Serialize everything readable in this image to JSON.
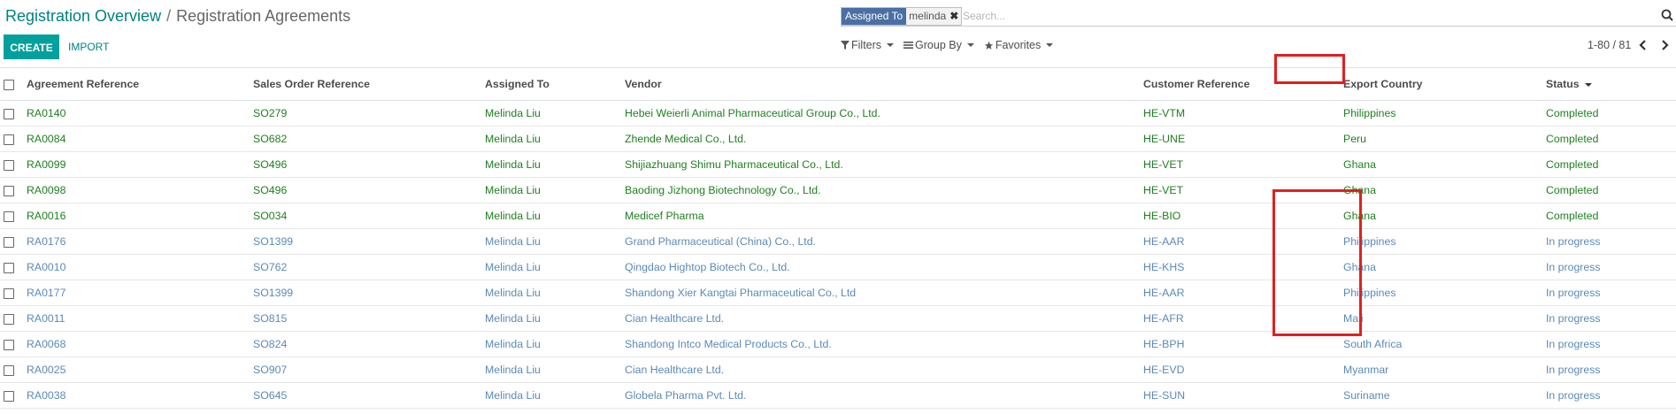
{
  "breadcrumb": {
    "root": "Registration Overview",
    "separator": "/",
    "current": "Registration Agreements"
  },
  "search": {
    "facet_label": "Assigned To",
    "facet_value": "melinda",
    "facet_remove": "✖",
    "placeholder": "Search..."
  },
  "toolbar": {
    "create_label": "CREATE",
    "import_label": "IMPORT"
  },
  "filters": {
    "filters_label": "Filters",
    "group_by_label": "Group By",
    "favorites_label": "Favorites"
  },
  "pager": {
    "text": "1-80 / 81"
  },
  "table": {
    "columns": [
      "Agreement Reference",
      "Sales Order Reference",
      "Assigned To",
      "Vendor",
      "Customer Reference",
      "Export Country",
      "Status"
    ],
    "rows": [
      [
        "RA0140",
        "SO279",
        "Melinda Liu",
        "Hebei Weierli Animal Pharmaceutical Group Co., Ltd.",
        "HE-VTM",
        "Philippines",
        "Completed"
      ],
      [
        "RA0084",
        "SO682",
        "Melinda Liu",
        "Zhende Medical Co., Ltd.",
        "HE-UNE",
        "Peru",
        "Completed"
      ],
      [
        "RA0099",
        "SO496",
        "Melinda Liu",
        "Shijiazhuang Shimu Pharmaceutical Co., Ltd.",
        "HE-VET",
        "Ghana",
        "Completed"
      ],
      [
        "RA0098",
        "SO496",
        "Melinda Liu",
        "Baoding Jizhong Biotechnology Co., Ltd.",
        "HE-VET",
        "Ghana",
        "Completed"
      ],
      [
        "RA0016",
        "SO034",
        "Melinda Liu",
        "Medicef Pharma",
        "HE-BIO",
        "Ghana",
        "Completed"
      ],
      [
        "RA0176",
        "SO1399",
        "Melinda Liu",
        "Grand Pharmaceutical (China) Co., Ltd.",
        "HE-AAR",
        "Philippines",
        "In progress"
      ],
      [
        "RA0010",
        "SO762",
        "Melinda Liu",
        "Qingdao Hightop Biotech Co., Ltd.",
        "HE-KHS",
        "Ghana",
        "In progress"
      ],
      [
        "RA0177",
        "SO1399",
        "Melinda Liu",
        "Shandong Xier Kangtai Pharmaceutical Co., Ltd",
        "HE-AAR",
        "Philippines",
        "In progress"
      ],
      [
        "RA0011",
        "SO815",
        "Melinda Liu",
        "Cian Healthcare Ltd.",
        "HE-AFR",
        "Mali",
        "In progress"
      ],
      [
        "RA0068",
        "SO824",
        "Melinda Liu",
        "Shandong Intco Medical Products Co., Ltd.",
        "HE-BPH",
        "South Africa",
        "In progress"
      ],
      [
        "RA0025",
        "SO907",
        "Melinda Liu",
        "Cian Healthcare Ltd.",
        "HE-EVD",
        "Myanmar",
        "In progress"
      ],
      [
        "RA0038",
        "SO645",
        "Melinda Liu",
        "Globela Pharma Pvt. Ltd.",
        "HE-SUN",
        "Suriname",
        "In progress"
      ]
    ]
  },
  "colors": {
    "brand": "#00a09d",
    "completed": "#1f7f1f",
    "in_progress": "#5a8ab8",
    "highlight": "#e02020",
    "facet": "#4a6fa5"
  }
}
